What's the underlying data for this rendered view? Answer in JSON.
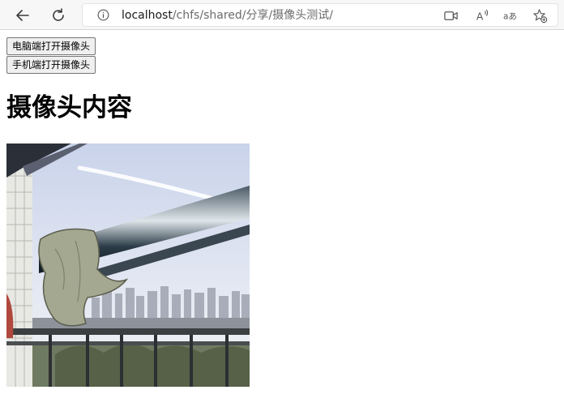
{
  "browser": {
    "url_host": "localhost",
    "url_path": "/chfs/shared/分享/摄像头测试/",
    "icons": [
      "back-icon",
      "refresh-icon",
      "info-icon",
      "video-camera-icon",
      "read-aloud-icon",
      "translate-icon",
      "add-favorite-icon"
    ],
    "read_glyph": "A",
    "translate_glyph": "aあ"
  },
  "page": {
    "pc_camera_button": "电脑端打开摄像头",
    "phone_camera_button": "手机端打开摄像头",
    "heading": "摄像头内容"
  },
  "camera_view": {
    "description_icon": "camera-feed-image"
  }
}
